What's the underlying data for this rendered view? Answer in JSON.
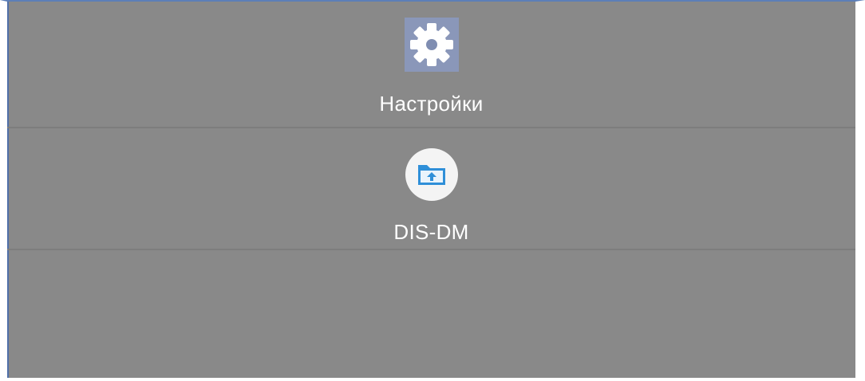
{
  "apps": [
    {
      "label": "Настройки",
      "icon": "gear-icon"
    },
    {
      "label": "DIS-DM",
      "icon": "folder-upload-icon"
    }
  ],
  "colors": {
    "background": "#898989",
    "divider": "#7d7d7d",
    "settings_icon_bg": "#8a97b9",
    "dm_icon_accent": "#2f8fd8"
  }
}
